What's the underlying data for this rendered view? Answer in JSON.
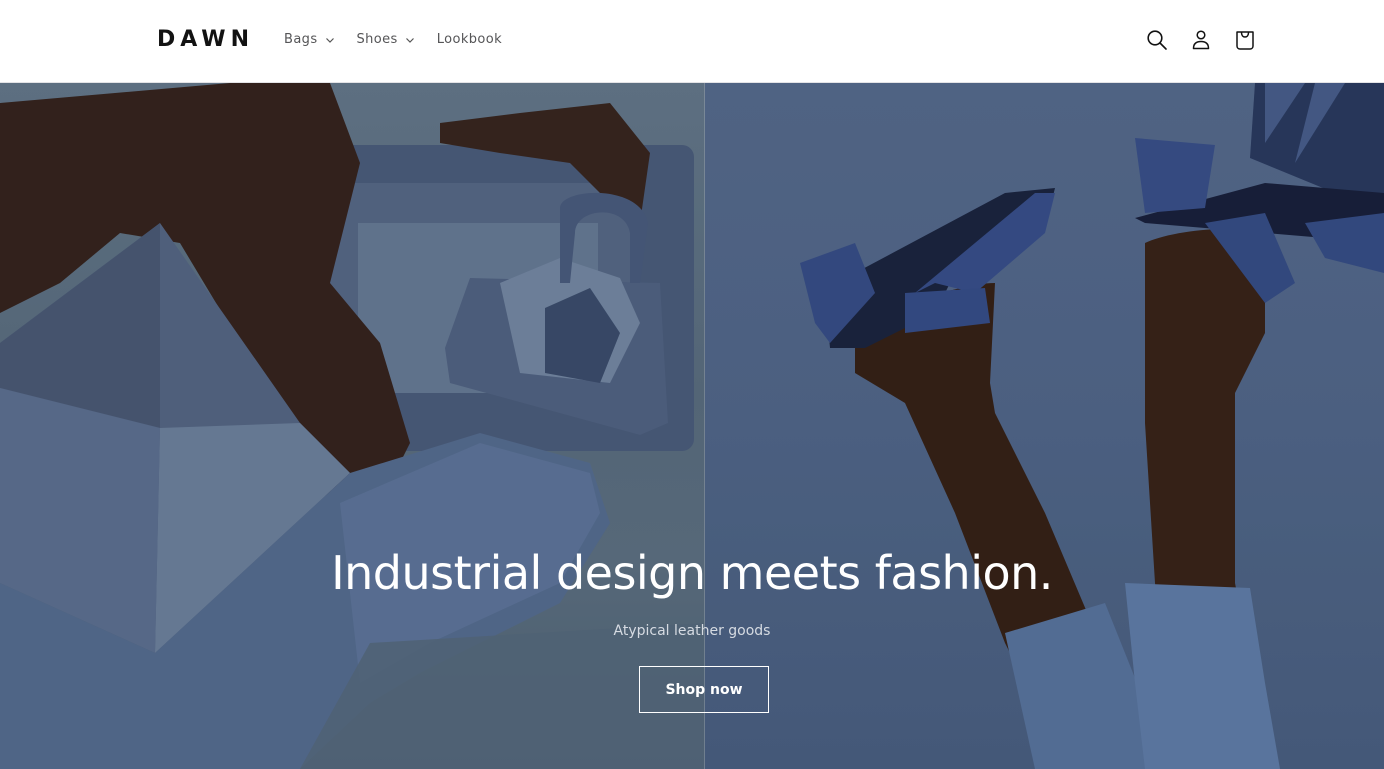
{
  "header": {
    "logo": "DAWN",
    "nav": [
      {
        "label": "Bags",
        "has_dropdown": true
      },
      {
        "label": "Shoes",
        "has_dropdown": true
      },
      {
        "label": "Lookbook",
        "has_dropdown": false
      }
    ],
    "icons": [
      "search-icon",
      "account-icon",
      "cart-icon"
    ]
  },
  "hero": {
    "title": "Industrial design meets fashion.",
    "subtitle": "Atypical leather goods",
    "button_label": "Shop now",
    "images": [
      {
        "description": "model with geometric leather bags, slate blue background"
      },
      {
        "description": "legs wearing blue heeled mules, blue background"
      }
    ]
  },
  "colors": {
    "header_bg": "#ffffff",
    "text": "#121212",
    "nav_text": "#555557",
    "hero_left_bg": "#62778a",
    "hero_right_bg": "#566d92",
    "hero_text": "#ffffff"
  }
}
